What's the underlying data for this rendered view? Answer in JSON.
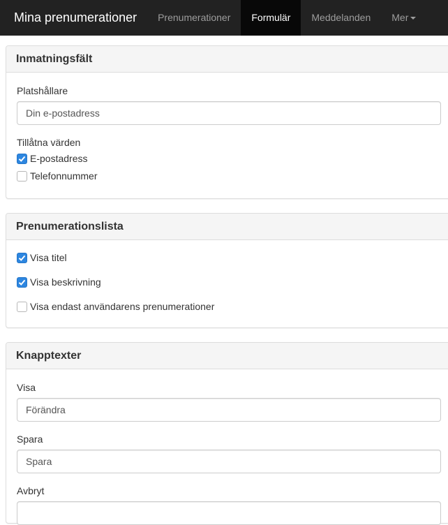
{
  "navbar": {
    "brand": "Mina prenumerationer",
    "items": [
      "Prenumerationer",
      "Formulär",
      "Meddelanden",
      "Mer"
    ],
    "active": "Formulär"
  },
  "input_panel": {
    "title": "Inmatningsfält",
    "placeholder_label": "Platshållare",
    "placeholder_value": "Din e-postadress",
    "allowed_label": "Tillåtna värden",
    "options": [
      {
        "label": "E-postadress",
        "checked": true
      },
      {
        "label": "Telefonnummer",
        "checked": false
      }
    ]
  },
  "list_panel": {
    "title": "Prenumerationslista",
    "options": [
      {
        "label": "Visa titel",
        "checked": true
      },
      {
        "label": "Visa beskrivning",
        "checked": true
      },
      {
        "label": "Visa endast användarens prenumerationer",
        "checked": false
      }
    ]
  },
  "button_panel": {
    "title": "Knapptexter",
    "fields": [
      {
        "label": "Visa",
        "value": "Förändra"
      },
      {
        "label": "Spara",
        "value": "Spara"
      },
      {
        "label": "Avbryt",
        "value": ""
      }
    ]
  },
  "colors": {
    "navbar_bg": "#222222",
    "navbar_active_bg": "#080808",
    "checkbox_checked": "#2d86e0"
  }
}
